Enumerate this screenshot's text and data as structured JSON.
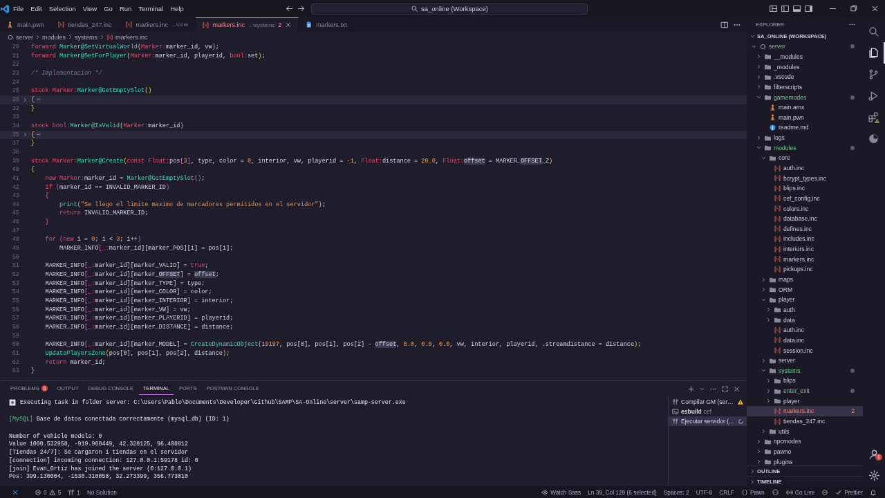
{
  "window": {
    "title": "sa_online (Workspace)"
  },
  "menu": [
    "File",
    "Edit",
    "Selection",
    "View",
    "Go",
    "Run",
    "Terminal",
    "Help"
  ],
  "tabs": [
    {
      "label": "main.pwn",
      "kind": "pawn",
      "selected": false
    },
    {
      "label": "tiendas_247.inc",
      "kind": "inc",
      "selected": false
    },
    {
      "label": "markers.inc",
      "description": "...\\core",
      "kind": "inc",
      "selected": false
    },
    {
      "label": "markers.inc",
      "description": "...\\systems",
      "count": "2",
      "kind": "inc",
      "selected": true
    },
    {
      "label": "markers.txt",
      "kind": "txt",
      "selected": false
    }
  ],
  "breadcrumb": [
    "server",
    "modules",
    "systems",
    "markers.inc"
  ],
  "editor": {
    "lines": [
      {
        "number": "20",
        "folded": false,
        "tokens": [
          {
            "text": "forward ",
            "kind": "kw"
          },
          {
            "text": "Marker@SetVirtualWorld",
            "kind": "fn"
          },
          {
            "text": "(",
            "kind": "br1"
          },
          {
            "text": "Marker:",
            "kind": "kw"
          },
          {
            "text": "marker_id, vw",
            "kind": "pl"
          },
          {
            "text": ")",
            "kind": "br1"
          },
          {
            "text": ";",
            "kind": "pl"
          }
        ]
      },
      {
        "number": "21",
        "folded": false,
        "tokens": [
          {
            "text": "forward ",
            "kind": "kw"
          },
          {
            "text": "Marker@SetForPlayer",
            "kind": "fn"
          },
          {
            "text": "(",
            "kind": "br1"
          },
          {
            "text": "Marker:",
            "kind": "kw"
          },
          {
            "text": "marker_id, playerid, ",
            "kind": "pl"
          },
          {
            "text": "bool:",
            "kind": "kw"
          },
          {
            "text": "set",
            "kind": "pl"
          },
          {
            "text": ")",
            "kind": "br1"
          },
          {
            "text": ";",
            "kind": "pl"
          }
        ]
      },
      {
        "number": "22",
        "folded": false
      },
      {
        "number": "23",
        "folded": false,
        "tokens": [
          {
            "text": "/* Implementacion */",
            "kind": "com"
          }
        ]
      },
      {
        "number": "24",
        "folded": false
      },
      {
        "number": "25",
        "folded": false,
        "tokens": [
          {
            "text": "stock ",
            "kind": "kw"
          },
          {
            "text": "Marker:",
            "kind": "kw"
          },
          {
            "text": "Marker@GetEmptySlot",
            "kind": "fn"
          },
          {
            "text": "()",
            "kind": "br1"
          }
        ]
      },
      {
        "number": "26",
        "folded": true,
        "tokens": [
          {
            "text": "{",
            "kind": "br1"
          },
          {
            "text": "⋯",
            "kind": "fold"
          }
        ]
      },
      {
        "number": "32",
        "folded": false,
        "tokens": [
          {
            "text": "}",
            "kind": "br1"
          }
        ]
      },
      {
        "number": "33",
        "folded": false
      },
      {
        "number": "34",
        "folded": false,
        "tokens": [
          {
            "text": "stock ",
            "kind": "kw"
          },
          {
            "text": "bool:",
            "kind": "kw"
          },
          {
            "text": "Marker@IsValid",
            "kind": "fn"
          },
          {
            "text": "(",
            "kind": "br1"
          },
          {
            "text": "Marker:",
            "kind": "kw"
          },
          {
            "text": "marker_id",
            "kind": "pl"
          },
          {
            "text": ")",
            "kind": "br1"
          }
        ]
      },
      {
        "number": "35",
        "folded": true,
        "tokens": [
          {
            "text": "{",
            "kind": "br1"
          },
          {
            "text": "⋯",
            "kind": "fold"
          }
        ]
      },
      {
        "number": "37",
        "folded": false,
        "tokens": [
          {
            "text": "}",
            "kind": "br1"
          }
        ]
      },
      {
        "number": "38",
        "folded": false
      },
      {
        "number": "39",
        "folded": false,
        "tokens": [
          {
            "text": "stock ",
            "kind": "kw"
          },
          {
            "text": "Marker:",
            "kind": "kw"
          },
          {
            "text": "Marker@Create",
            "kind": "fn"
          },
          {
            "text": "(",
            "kind": "br1"
          },
          {
            "text": "const Float:",
            "kind": "kw"
          },
          {
            "text": "pos",
            "kind": "pl"
          },
          {
            "text": "[",
            "kind": "br2"
          },
          {
            "text": "3",
            "kind": "num"
          },
          {
            "text": "]",
            "kind": "br2"
          },
          {
            "text": ", type, color = ",
            "kind": "pl"
          },
          {
            "text": "0",
            "kind": "num"
          },
          {
            "text": ", interior, vw, playerid = ",
            "kind": "pl"
          },
          {
            "text": "-1",
            "kind": "num"
          },
          {
            "text": ", ",
            "kind": "pl"
          },
          {
            "text": "Float:",
            "kind": "kw"
          },
          {
            "text": "distance = ",
            "kind": "pl"
          },
          {
            "text": "20.0",
            "kind": "num"
          },
          {
            "text": ", ",
            "kind": "pl"
          },
          {
            "text": "Float:",
            "kind": "kw"
          },
          {
            "text": "offset",
            "kind": "hl"
          },
          {
            "text": " = MARKER_",
            "kind": "pl"
          },
          {
            "text": "OFFSET",
            "kind": "hl"
          },
          {
            "text": "_Z",
            "kind": "pl"
          },
          {
            "text": ")",
            "kind": "br1"
          }
        ]
      },
      {
        "number": "40",
        "folded": false,
        "tokens": [
          {
            "text": "{",
            "kind": "br1"
          }
        ]
      },
      {
        "number": "41",
        "folded": false,
        "tokens": [
          {
            "text": "    new ",
            "kind": "kw"
          },
          {
            "text": "Marker:",
            "kind": "kw"
          },
          {
            "text": "marker_id = ",
            "kind": "pl"
          },
          {
            "text": "Marker@GetEmptySlot",
            "kind": "fn"
          },
          {
            "text": "()",
            "kind": "br2"
          },
          {
            "text": ";",
            "kind": "pl"
          }
        ]
      },
      {
        "number": "42",
        "folded": false,
        "tokens": [
          {
            "text": "    if ",
            "kind": "kw"
          },
          {
            "text": "(",
            "kind": "br2"
          },
          {
            "text": "marker_id == INVALID_MARKER_ID",
            "kind": "pl"
          },
          {
            "text": ")",
            "kind": "br2"
          }
        ]
      },
      {
        "number": "43",
        "folded": false,
        "tokens": [
          {
            "text": "    {",
            "kind": "br2"
          }
        ]
      },
      {
        "number": "44",
        "folded": false,
        "tokens": [
          {
            "text": "        print",
            "kind": "fn"
          },
          {
            "text": "(",
            "kind": "br1"
          },
          {
            "text": "\"Se llego el limite maximo de marcadores permitidos en el servidor\"",
            "kind": "str"
          },
          {
            "text": ")",
            "kind": "br1"
          },
          {
            "text": ";",
            "kind": "pl"
          }
        ]
      },
      {
        "number": "45",
        "folded": false,
        "tokens": [
          {
            "text": "        return",
            "kind": "kw"
          },
          {
            "text": " INVALID_MARKER_ID;",
            "kind": "pl"
          }
        ]
      },
      {
        "number": "46",
        "folded": false,
        "tokens": [
          {
            "text": "    }",
            "kind": "br2"
          }
        ]
      },
      {
        "number": "47",
        "folded": false
      },
      {
        "number": "48",
        "folded": false,
        "tokens": [
          {
            "text": "    for ",
            "kind": "kw"
          },
          {
            "text": "(",
            "kind": "br2"
          },
          {
            "text": "new",
            "kind": "kw"
          },
          {
            "text": " i = ",
            "kind": "pl"
          },
          {
            "text": "0",
            "kind": "num"
          },
          {
            "text": "; i < ",
            "kind": "pl"
          },
          {
            "text": "3",
            "kind": "num"
          },
          {
            "text": "; i++",
            "kind": "pl"
          },
          {
            "text": ")",
            "kind": "br2"
          }
        ]
      },
      {
        "number": "49",
        "folded": false,
        "tokens": [
          {
            "text": "        MARKER_INFO",
            "kind": "pl"
          },
          {
            "text": "[",
            "kind": "br2"
          },
          {
            "text": "_:",
            "kind": "kw"
          },
          {
            "text": "marker_id][marker_POS][i] = pos[i];",
            "kind": "pl"
          }
        ]
      },
      {
        "number": "50",
        "folded": false
      },
      {
        "number": "51",
        "folded": false,
        "tokens": [
          {
            "text": "    MARKER_INFO",
            "kind": "pl"
          },
          {
            "text": "[",
            "kind": "br2"
          },
          {
            "text": "_:",
            "kind": "kw"
          },
          {
            "text": "marker_id][marker_VALID] = ",
            "kind": "pl"
          },
          {
            "text": "true",
            "kind": "kw"
          },
          {
            "text": ";",
            "kind": "pl"
          }
        ]
      },
      {
        "number": "52",
        "folded": false,
        "tokens": [
          {
            "text": "    MARKER_INFO",
            "kind": "pl"
          },
          {
            "text": "[",
            "kind": "br2"
          },
          {
            "text": "_:",
            "kind": "kw"
          },
          {
            "text": "marker_id][marker_",
            "kind": "pl"
          },
          {
            "text": "OFFSET",
            "kind": "hl"
          },
          {
            "text": "] = ",
            "kind": "pl"
          },
          {
            "text": "offset",
            "kind": "hl"
          },
          {
            "text": ";",
            "kind": "pl"
          }
        ]
      },
      {
        "number": "53",
        "folded": false,
        "tokens": [
          {
            "text": "    MARKER_INFO",
            "kind": "pl"
          },
          {
            "text": "[",
            "kind": "br2"
          },
          {
            "text": "_:",
            "kind": "kw"
          },
          {
            "text": "marker_id][marker_TYPE] = type;",
            "kind": "pl"
          }
        ]
      },
      {
        "number": "54",
        "folded": false,
        "tokens": [
          {
            "text": "    MARKER_INFO",
            "kind": "pl"
          },
          {
            "text": "[",
            "kind": "br2"
          },
          {
            "text": "_:",
            "kind": "kw"
          },
          {
            "text": "marker_id][marker_COLOR] = color;",
            "kind": "pl"
          }
        ]
      },
      {
        "number": "55",
        "folded": false,
        "tokens": [
          {
            "text": "    MARKER_INFO",
            "kind": "pl"
          },
          {
            "text": "[",
            "kind": "br2"
          },
          {
            "text": "_:",
            "kind": "kw"
          },
          {
            "text": "marker_id][marker_INTERIOR] = interior;",
            "kind": "pl"
          }
        ]
      },
      {
        "number": "56",
        "folded": false,
        "tokens": [
          {
            "text": "    MARKER_INFO",
            "kind": "pl"
          },
          {
            "text": "[",
            "kind": "br2"
          },
          {
            "text": "_:",
            "kind": "kw"
          },
          {
            "text": "marker_id][marker_VW] = vw;",
            "kind": "pl"
          }
        ]
      },
      {
        "number": "57",
        "folded": false,
        "tokens": [
          {
            "text": "    MARKER_INFO",
            "kind": "pl"
          },
          {
            "text": "[",
            "kind": "br2"
          },
          {
            "text": "_:",
            "kind": "kw"
          },
          {
            "text": "marker_id][marker_PLAYERID] = playerid;",
            "kind": "pl"
          }
        ]
      },
      {
        "number": "58",
        "folded": false,
        "tokens": [
          {
            "text": "    MARKER_INFO",
            "kind": "pl"
          },
          {
            "text": "[",
            "kind": "br2"
          },
          {
            "text": "_:",
            "kind": "kw"
          },
          {
            "text": "marker_id][marker_DISTANCE] = distance;",
            "kind": "pl"
          }
        ]
      },
      {
        "number": "59",
        "folded": false
      },
      {
        "number": "60",
        "folded": false,
        "tokens": [
          {
            "text": "    MARKER_INFO",
            "kind": "pl"
          },
          {
            "text": "[",
            "kind": "br2"
          },
          {
            "text": "_:",
            "kind": "kw"
          },
          {
            "text": "marker_id][marker_MODEL] = ",
            "kind": "pl"
          },
          {
            "text": "CreateDynamicObject",
            "kind": "fn"
          },
          {
            "text": "(",
            "kind": "br1"
          },
          {
            "text": "19197",
            "kind": "num"
          },
          {
            "text": ", pos[0], pos[1], pos[2] - ",
            "kind": "pl"
          },
          {
            "text": "offset",
            "kind": "hl"
          },
          {
            "text": ", ",
            "kind": "pl"
          },
          {
            "text": "0.0",
            "kind": "num"
          },
          {
            "text": ", ",
            "kind": "pl"
          },
          {
            "text": "0.0",
            "kind": "num"
          },
          {
            "text": ", ",
            "kind": "pl"
          },
          {
            "text": "0.0",
            "kind": "num"
          },
          {
            "text": ", vw, interior, playerid, .streamdistance = distance",
            "kind": "pl"
          },
          {
            "text": ")",
            "kind": "br1"
          },
          {
            "text": ";",
            "kind": "pl"
          }
        ]
      },
      {
        "number": "61",
        "folded": false,
        "tokens": [
          {
            "text": "    UpdatePlayersZone",
            "kind": "fn"
          },
          {
            "text": "(",
            "kind": "br1"
          },
          {
            "text": "pos[0], pos[1], pos[2], distance",
            "kind": "pl"
          },
          {
            "text": ")",
            "kind": "br1"
          },
          {
            "text": ";",
            "kind": "pl"
          }
        ]
      },
      {
        "number": "62",
        "folded": false,
        "tokens": [
          {
            "text": "    return",
            "kind": "kw"
          },
          {
            "text": " marker_id;",
            "kind": "pl"
          }
        ]
      },
      {
        "number": "63",
        "folded": false,
        "tokens": [
          {
            "text": "}",
            "kind": "br1"
          }
        ]
      }
    ]
  },
  "panel": {
    "tabs": [
      {
        "label": "PROBLEMS",
        "badge": "6",
        "selected": false
      },
      {
        "label": "OUTPUT",
        "selected": false
      },
      {
        "label": "DEBUG CONSOLE",
        "selected": false
      },
      {
        "label": "TERMINAL",
        "selected": true
      },
      {
        "label": "PORTS",
        "selected": false
      },
      {
        "label": "POSTMAN CONSOLE",
        "selected": false
      }
    ],
    "terminal": [
      {
        "kind": "task",
        "segments": [
          {
            "text": "Executing task in folder server: C:\\Users\\Pablo\\Documents\\Developer\\Github\\SAMP\\SA-Online\\server\\samp-server.exe",
            "kind": "plain"
          }
        ]
      },
      {
        "kind": "blank"
      },
      {
        "kind": "text",
        "segments": [
          {
            "text": "[MySQL]",
            "kind": "green"
          },
          {
            "text": " Base de datos conectada correctamente (mysql_db) (ID: 1)",
            "kind": "plain"
          }
        ]
      },
      {
        "kind": "blank"
      },
      {
        "kind": "text",
        "segments": [
          {
            "text": "Number of vehicle models: 0",
            "kind": "plain"
          }
        ]
      },
      {
        "kind": "text",
        "segments": [
          {
            "text": "Value 1000.532958, -919.960449, 42.328125, 96.408912",
            "kind": "plain"
          }
        ]
      },
      {
        "kind": "text",
        "segments": [
          {
            "text": "[Tiendas 24/7]: Se cargaron 1 tiendas en el servidor",
            "kind": "plain"
          }
        ]
      },
      {
        "kind": "text",
        "segments": [
          {
            "text": "[connection] incoming connection: 127.0.0.1:59178 id: 0",
            "kind": "plain"
          }
        ]
      },
      {
        "kind": "text",
        "segments": [
          {
            "text": "[join] Evan_Ortiz has joined the server (0:127.0.0.1)",
            "kind": "plain"
          }
        ]
      },
      {
        "kind": "text",
        "segments": [
          {
            "text": "Pos: 399.130004, -1530.310058, 32.273399, 356.773010",
            "kind": "plain"
          }
        ]
      }
    ],
    "sessions": [
      {
        "name": "Compilar GM (ser…",
        "kind": "task",
        "warning": true,
        "running": false,
        "selected": false
      },
      {
        "name": "esbuild",
        "description": "cef",
        "kind": "shell",
        "warning": false,
        "running": false,
        "selected": false
      },
      {
        "name": "Ejecutar servidor (…",
        "kind": "task",
        "warning": false,
        "running": true,
        "selected": true
      }
    ]
  },
  "explorer": {
    "title": "EXPLORER",
    "workspace": "SA_ONLINE (WORKSPACE)",
    "tree": [
      {
        "label": "server",
        "kind": "root",
        "expanded": true,
        "modified": true,
        "selected": false,
        "children": [
          {
            "label": "__modules",
            "kind": "folder",
            "expanded": false,
            "modified": false,
            "selected": false
          },
          {
            "label": "_modules",
            "kind": "folder",
            "expanded": false,
            "modified": false,
            "selected": false
          },
          {
            "label": ".vscode",
            "kind": "folder",
            "expanded": false,
            "modified": false,
            "selected": false
          },
          {
            "label": "filterscripts",
            "kind": "folder",
            "expanded": false,
            "modified": false,
            "selected": false
          },
          {
            "label": "gamemodes",
            "kind": "folder",
            "expanded": true,
            "modified": true,
            "selected": false,
            "children": [
              {
                "label": "main.amx",
                "kind": "pawn",
                "modified": false,
                "selected": false
              },
              {
                "label": "main.pwn",
                "kind": "pawn",
                "modified": false,
                "selected": false
              },
              {
                "label": "readme.md",
                "kind": "info",
                "modified": false,
                "selected": false
              }
            ]
          },
          {
            "label": "logs",
            "kind": "folder",
            "expanded": false,
            "modified": false,
            "selected": false
          },
          {
            "label": "modules",
            "kind": "folder",
            "expanded": true,
            "modified": true,
            "selected": false,
            "children": [
              {
                "label": "core",
                "kind": "folder",
                "expanded": true,
                "modified": false,
                "selected": false,
                "children": [
                  {
                    "label": "auth.inc",
                    "kind": "inc",
                    "modified": false,
                    "selected": false
                  },
                  {
                    "label": "bcrypt_types.inc",
                    "kind": "inc",
                    "modified": false,
                    "selected": false
                  },
                  {
                    "label": "blips.inc",
                    "kind": "inc",
                    "modified": false,
                    "selected": false
                  },
                  {
                    "label": "cef_config.inc",
                    "kind": "inc",
                    "modified": false,
                    "selected": false
                  },
                  {
                    "label": "colors.inc",
                    "kind": "inc",
                    "modified": false,
                    "selected": false
                  },
                  {
                    "label": "database.inc",
                    "kind": "inc",
                    "modified": false,
                    "selected": false
                  },
                  {
                    "label": "defines.inc",
                    "kind": "inc",
                    "modified": false,
                    "selected": false
                  },
                  {
                    "label": "includes.inc",
                    "kind": "inc",
                    "modified": false,
                    "selected": false
                  },
                  {
                    "label": "interiors.inc",
                    "kind": "inc",
                    "modified": false,
                    "selected": false
                  },
                  {
                    "label": "markers.inc",
                    "kind": "inc",
                    "modified": false,
                    "selected": false
                  },
                  {
                    "label": "pickups.inc",
                    "kind": "inc",
                    "modified": false,
                    "selected": false
                  }
                ]
              },
              {
                "label": "maps",
                "kind": "folder",
                "expanded": false,
                "modified": false,
                "selected": false
              },
              {
                "label": "ORM",
                "kind": "folder",
                "expanded": false,
                "modified": false,
                "selected": false
              },
              {
                "label": "player",
                "kind": "folder",
                "expanded": true,
                "modified": false,
                "selected": false,
                "children": [
                  {
                    "label": "auth",
                    "kind": "folder",
                    "expanded": false,
                    "modified": false,
                    "selected": false
                  },
                  {
                    "label": "data",
                    "kind": "folder",
                    "expanded": false,
                    "modified": false,
                    "selected": false
                  },
                  {
                    "label": "auth.inc",
                    "kind": "inc",
                    "modified": false,
                    "selected": false
                  },
                  {
                    "label": "data.inc",
                    "kind": "inc",
                    "modified": false,
                    "selected": false
                  },
                  {
                    "label": "session.inc",
                    "kind": "inc",
                    "modified": false,
                    "selected": false
                  }
                ]
              },
              {
                "label": "server",
                "kind": "folder",
                "expanded": false,
                "modified": false,
                "selected": false
              },
              {
                "label": "systems",
                "kind": "folder",
                "expanded": true,
                "modified": true,
                "selected": false,
                "children": [
                  {
                    "label": "blips",
                    "kind": "folder",
                    "expanded": false,
                    "modified": false,
                    "selected": false
                  },
                  {
                    "label": "enter_exit",
                    "kind": "folder",
                    "expanded": false,
                    "modified": true,
                    "selected": false
                  },
                  {
                    "label": "player",
                    "kind": "folder",
                    "expanded": false,
                    "modified": false,
                    "selected": false
                  },
                  {
                    "label": "markers.inc",
                    "kind": "inc",
                    "modified": false,
                    "selected": true,
                    "badge": "2"
                  },
                  {
                    "label": "tiendas_247.inc",
                    "kind": "inc",
                    "modified": false,
                    "selected": false
                  }
                ]
              },
              {
                "label": "utils",
                "kind": "folder",
                "expanded": false,
                "modified": false,
                "selected": false
              }
            ]
          },
          {
            "label": "npcmodes",
            "kind": "folder",
            "expanded": false,
            "modified": false,
            "selected": false
          },
          {
            "label": "pawno",
            "kind": "folder",
            "expanded": false,
            "modified": false,
            "selected": false
          },
          {
            "label": "plugins",
            "kind": "folder",
            "expanded": false,
            "modified": false,
            "selected": false
          }
        ]
      }
    ],
    "sections": [
      "OUTLINE",
      "TIMELINE"
    ]
  },
  "activity_bar": {
    "items": [
      {
        "selected": false
      },
      {
        "selected": true
      },
      {
        "selected": false
      },
      {
        "selected": false
      },
      {
        "selected": false
      },
      {
        "selected": false
      }
    ],
    "account_badge": "1"
  },
  "status_bar": {
    "errors": "0",
    "warnings": "5",
    "ports": "1",
    "solution": "No Solution",
    "items": [
      {
        "label": "Watch Sass",
        "kind": "watch"
      },
      {
        "label": "Ln 39, Col 129 (6 selected)",
        "kind": "text"
      },
      {
        "label": "Spaces: 2",
        "kind": "text"
      },
      {
        "label": "UTF-8",
        "kind": "text"
      },
      {
        "label": "CRLF",
        "kind": "text"
      },
      {
        "label": "Pawn",
        "kind": "language"
      },
      {
        "label": "Go Live",
        "kind": "live"
      },
      {
        "label": "Prettier",
        "kind": "prettier"
      }
    ]
  }
}
